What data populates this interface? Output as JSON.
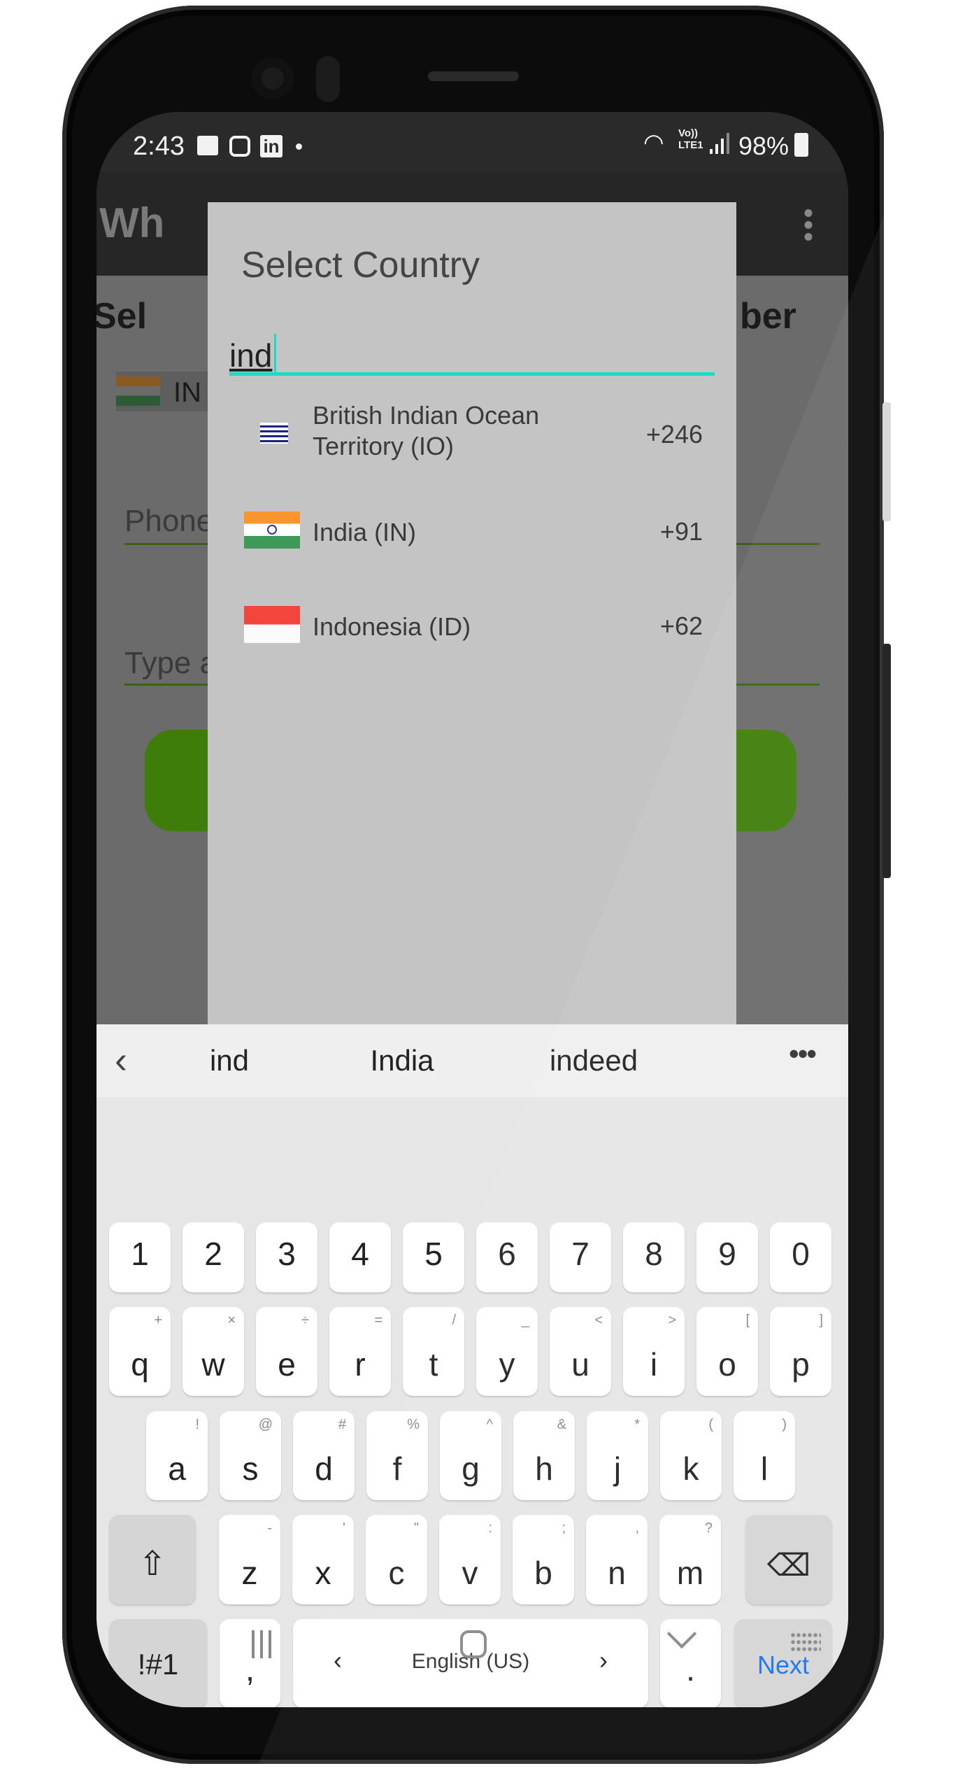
{
  "status_bar": {
    "time": "2:43",
    "notification_icons": [
      "gallery-icon",
      "instagram-icon",
      "linkedin-icon",
      "dot-icon"
    ],
    "network_label_top": "Vo))",
    "network_label_bottom": "LTE1",
    "battery": "98%"
  },
  "app": {
    "title_partial": "Wh",
    "heading_left": "Sel",
    "heading_right": "ber",
    "country_chip": "IN",
    "phone_hint": "Phone",
    "message_hint": "Type a",
    "primary_color": "#4a9a0a"
  },
  "dialog": {
    "title": "Select Country",
    "search_value": "ind",
    "accent": "#1ed8c8",
    "results": [
      {
        "name_line1": "British Indian Ocean",
        "name_line2": "Territory (IO)",
        "code": "+246",
        "flag": "biot-flag"
      },
      {
        "name_line1": "India (IN)",
        "name_line2": "",
        "code": "+91",
        "flag": "india-flag"
      },
      {
        "name_line1": "Indonesia (ID)",
        "name_line2": "",
        "code": "+62",
        "flag": "indonesia-flag"
      }
    ]
  },
  "keyboard": {
    "suggestions": [
      "ind",
      "India",
      "indeed"
    ],
    "numbers": [
      "1",
      "2",
      "3",
      "4",
      "5",
      "6",
      "7",
      "8",
      "9",
      "0"
    ],
    "row1": [
      [
        "q",
        "+"
      ],
      [
        "w",
        "×"
      ],
      [
        "e",
        "÷"
      ],
      [
        "r",
        "="
      ],
      [
        "t",
        "/"
      ],
      [
        "y",
        "_"
      ],
      [
        "u",
        "<"
      ],
      [
        "i",
        ">"
      ],
      [
        "o",
        "["
      ],
      [
        "p",
        "]"
      ]
    ],
    "row2": [
      [
        "a",
        "!"
      ],
      [
        "s",
        "@"
      ],
      [
        "d",
        "#"
      ],
      [
        "f",
        "%"
      ],
      [
        "g",
        "^"
      ],
      [
        "h",
        "&"
      ],
      [
        "j",
        "*"
      ],
      [
        "k",
        "("
      ],
      [
        "l",
        ")"
      ]
    ],
    "row3": [
      [
        "z",
        "-"
      ],
      [
        "x",
        "'"
      ],
      [
        "c",
        "\""
      ],
      [
        "v",
        ":"
      ],
      [
        "b",
        ";"
      ],
      [
        "n",
        ","
      ],
      [
        "m",
        "?"
      ]
    ],
    "symbols_label": "!#1",
    "comma": ",",
    "language": "English (US)",
    "period": ".",
    "action_label": "Next",
    "action_color": "#1a73e8"
  }
}
